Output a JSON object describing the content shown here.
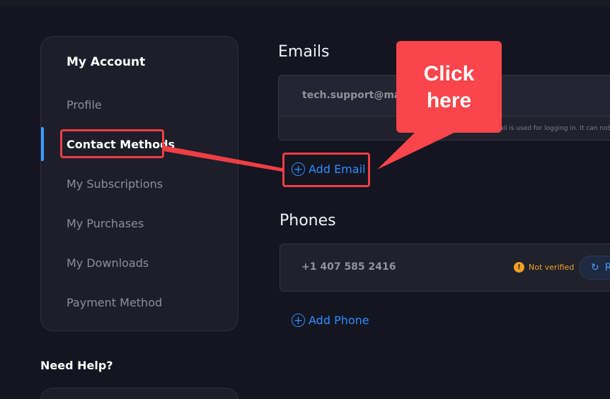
{
  "sidebar": {
    "heading": "My Account",
    "items": [
      {
        "label": "Profile"
      },
      {
        "label": "Contact Methods"
      },
      {
        "label": "My Subscriptions"
      },
      {
        "label": "My Purchases"
      },
      {
        "label": "My Downloads"
      },
      {
        "label": "Payment Method"
      }
    ],
    "active_index": 1
  },
  "help": {
    "title": "Need Help?"
  },
  "emails": {
    "title": "Emails",
    "address": "tech.support@mar",
    "note": "ail is used for logging in. It can not b",
    "add_label": "Add Email"
  },
  "phones": {
    "title": "Phones",
    "number": "+1 407 585 2416",
    "status": "Not verified",
    "verify_label": "R",
    "add_label": "Add Phone"
  },
  "annotation": {
    "callout_line1": "Click",
    "callout_line2": "here",
    "color": "#ef3e45"
  },
  "colors": {
    "background": "#131520",
    "accent": "#2f8cff",
    "warning": "#f0a020"
  }
}
